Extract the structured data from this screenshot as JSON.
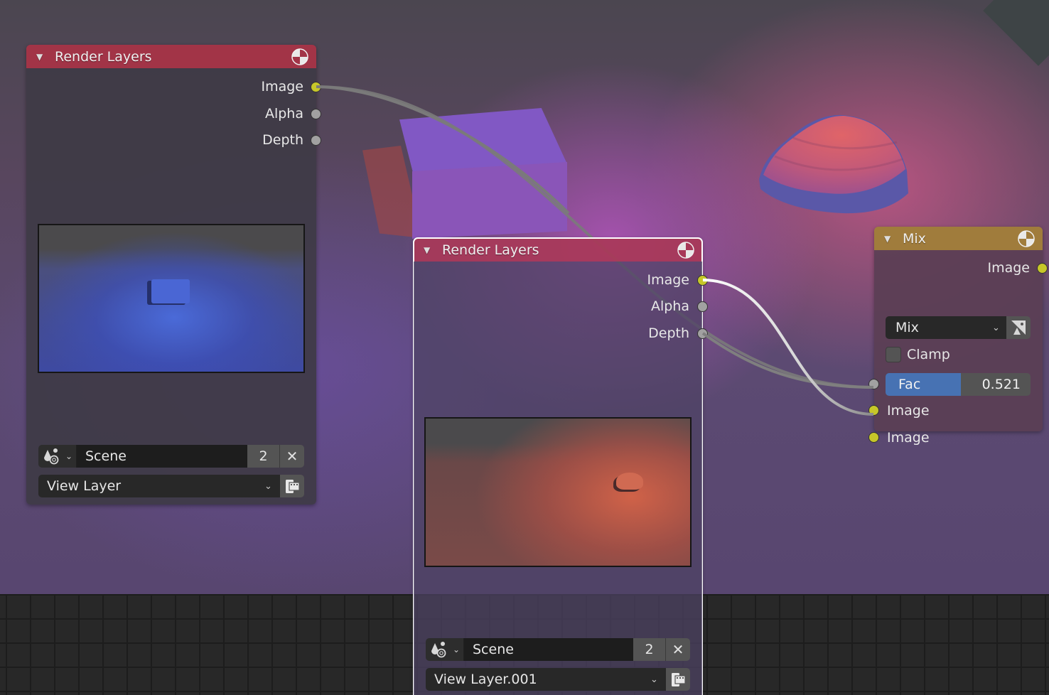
{
  "editor": "Compositor Node Editor",
  "colors": {
    "render_layers_header": "#a23447",
    "mix_header": "#a07c3c",
    "color_socket": "#c7c729",
    "value_socket": "#a1a1a1",
    "fac_fill": "#4772b3"
  },
  "nodes": [
    {
      "id": "render_layers_1",
      "title": "Render Layers",
      "collapse_icon": "triangle-down-icon",
      "header_icon": "render-result-icon",
      "outputs": [
        {
          "label": "Image",
          "type": "color"
        },
        {
          "label": "Alpha",
          "type": "value"
        },
        {
          "label": "Depth",
          "type": "value"
        }
      ],
      "preview": "blue cube render",
      "scene": {
        "browse_icon": "scene-data-icon",
        "name": "Scene",
        "users": "2",
        "unlink_icon": "close-icon"
      },
      "view_layer": {
        "value": "View Layer",
        "render_icon": "render-layer-icon"
      },
      "selected": false
    },
    {
      "id": "render_layers_2",
      "title": "Render Layers",
      "collapse_icon": "triangle-down-icon",
      "header_icon": "render-result-icon",
      "outputs": [
        {
          "label": "Image",
          "type": "color"
        },
        {
          "label": "Alpha",
          "type": "value"
        },
        {
          "label": "Depth",
          "type": "value"
        }
      ],
      "preview": "red dome render",
      "scene": {
        "browse_icon": "scene-data-icon",
        "name": "Scene",
        "users": "2",
        "unlink_icon": "close-icon"
      },
      "view_layer": {
        "value": "View Layer.001",
        "render_icon": "render-layer-icon"
      },
      "selected": true
    },
    {
      "id": "mix",
      "title": "Mix",
      "collapse_icon": "triangle-down-icon",
      "header_icon": "render-result-icon",
      "outputs": [
        {
          "label": "Image",
          "type": "color"
        }
      ],
      "blend_type": "Mix",
      "use_alpha_icon": "image-alpha-icon",
      "clamp": {
        "label": "Clamp",
        "checked": false
      },
      "fac": {
        "label": "Fac",
        "value": "0.521",
        "fraction": 0.521
      },
      "inputs": [
        {
          "label": "Image",
          "type": "color"
        },
        {
          "label": "Image",
          "type": "color"
        }
      ]
    }
  ],
  "links": [
    {
      "from": "render_layers_1.Image",
      "to": "mix.Image_1"
    },
    {
      "from": "render_layers_2.Image",
      "to": "mix.Image_2",
      "highlighted": true
    }
  ]
}
